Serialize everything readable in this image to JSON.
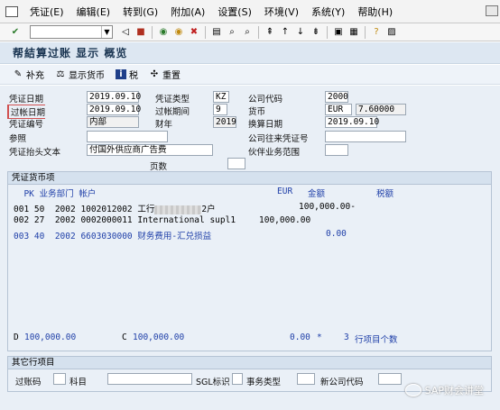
{
  "menu": [
    "凭证(E)",
    "编辑(E)",
    "转到(G)",
    "附加(A)",
    "设置(S)",
    "环境(V)",
    "系统(Y)",
    "帮助(H)"
  ],
  "title": "帮結算过账 显示 概览",
  "app_toolbar": {
    "supplement": "补充",
    "show_currency": "显示货币",
    "tax": "税",
    "reset": "重置"
  },
  "header": {
    "doc_date_label": "凭证日期",
    "doc_date": "2019.09.10",
    "doc_type_label": "凭证类型",
    "doc_type": "KZ",
    "company_code_label": "公司代码",
    "company_code": "2000",
    "posting_date_label": "过帐日期",
    "posting_date": "2019.09.10",
    "period_label": "过帐期间",
    "period": "9",
    "currency_label": "货币",
    "currency": "EUR",
    "rate": "7.60000",
    "doc_number_label": "凭证编号",
    "doc_number": "内部",
    "fiscal_year_label": "财年",
    "fiscal_year": "2019",
    "translation_date_label": "换算日期",
    "translation_date": "2019.09.10",
    "reference_label": "参照",
    "reference": "",
    "intercompany_label": "公司往来凭证号",
    "intercompany": "",
    "header_text_label": "凭证抬头文本",
    "header_text": "付国外供应商广告费",
    "partner_label": "伙伴业务范围",
    "partner": "",
    "pages_label": "页数",
    "pages": ""
  },
  "items": {
    "group_title": "凭证货币项",
    "col_header": "  PK 业务部门 帐户",
    "col_eur": "EUR",
    "col_amount": "金额",
    "col_tax": "税额",
    "rows": [
      {
        "no": "001",
        "pk": "50",
        "bu": "2002",
        "account": "1002012002",
        "text_prefix": "工行",
        "text_suffix": "2户",
        "amount": "100,000.00-",
        "highlight": false
      },
      {
        "no": "002",
        "pk": "27",
        "bu": "2002",
        "account": "0002000011",
        "text": "International supl1",
        "amount": "100,000.00",
        "highlight": false
      },
      {
        "no": "003",
        "pk": "40",
        "bu": "2002",
        "account": "6603030000",
        "text": "财务费用-汇兑损益",
        "amount": "0.00",
        "highlight": true
      }
    ],
    "debit_label": "D",
    "debit": "100,000.00",
    "credit_label": "C",
    "credit": "100,000.00",
    "balance": "0.00",
    "balance_flag": "*",
    "count": "3",
    "count_label": "行项目个数"
  },
  "other": {
    "group_title": "其它行项目",
    "posting_key_label": "过账码",
    "account_label": "科目",
    "sgl_label": "SGL标识",
    "trans_type_label": "事务类型",
    "new_company_label": "新公司代码"
  },
  "watermark": "SAP财会讲堂"
}
